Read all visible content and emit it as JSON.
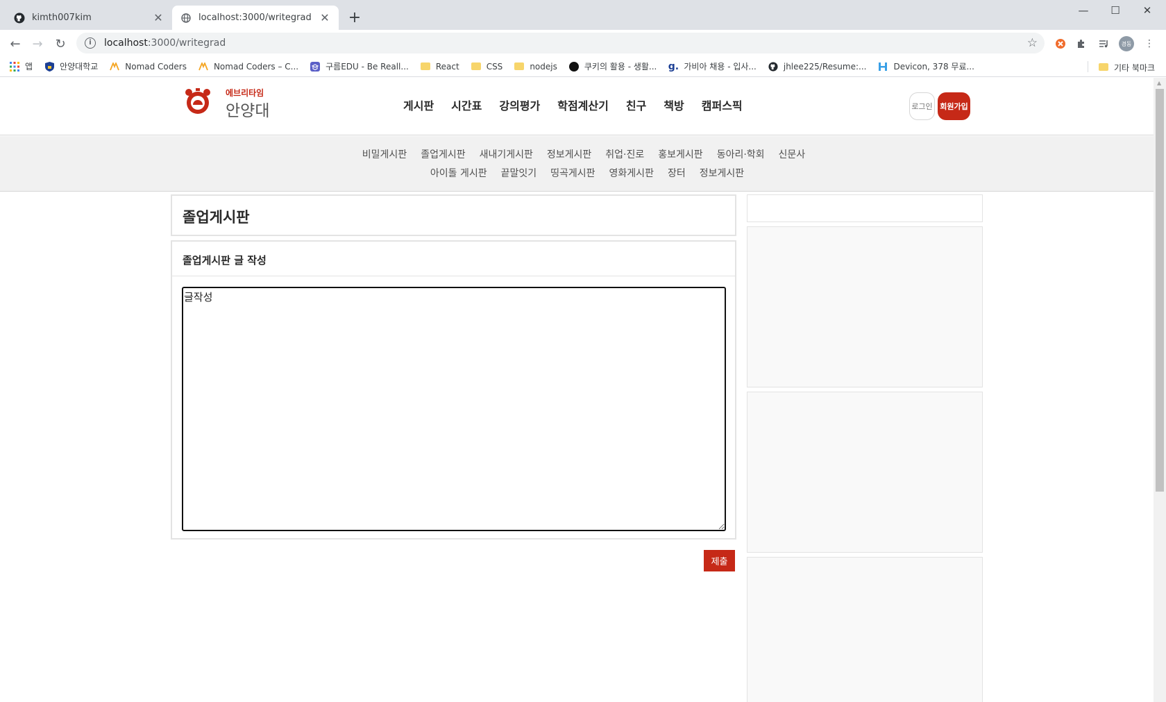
{
  "browser": {
    "tabs": [
      {
        "title": "kimth007kim",
        "close": "✕"
      },
      {
        "title": "localhost:3000/writegrad",
        "close": "✕"
      }
    ],
    "new_tab": "+",
    "window_controls": {
      "minimize": "—",
      "maximize": "☐",
      "close": "✕"
    },
    "nav": {
      "back": "←",
      "forward": "→",
      "reload": "↻"
    },
    "address": {
      "host": "localhost",
      "path": ":3000/writegrad"
    },
    "profile_label": "경동",
    "bookmarks": [
      {
        "label": "앱",
        "icon": "apps-grid-icon"
      },
      {
        "label": "안양대학교",
        "icon": "shield-icon"
      },
      {
        "label": "Nomad Coders",
        "icon": "nomad-icon"
      },
      {
        "label": "Nomad Coders – C...",
        "icon": "nomad-icon"
      },
      {
        "label": "구름EDU - Be Reall...",
        "icon": "goorm-icon"
      },
      {
        "label": "React",
        "icon": "folder-icon"
      },
      {
        "label": "CSS",
        "icon": "folder-icon"
      },
      {
        "label": "nodejs",
        "icon": "folder-icon"
      },
      {
        "label": "쿠키의 활용 - 생활...",
        "icon": "dot-icon"
      },
      {
        "label": "가비아 채용 - 입사...",
        "icon": "gabia-icon"
      },
      {
        "label": "jhlee225/Resume:...",
        "icon": "github-icon"
      },
      {
        "label": "Devicon, 378 무료...",
        "icon": "devicon-icon"
      }
    ],
    "other_bookmarks": "기타 북마크"
  },
  "site": {
    "logo_sub": "에브리타임",
    "logo_main": "안양대",
    "gnb": [
      "게시판",
      "시간표",
      "강의평가",
      "학점계산기",
      "친구",
      "책방",
      "캠퍼스픽"
    ],
    "login_label": "로그인",
    "signup_label": "회원가입",
    "subnav_row1": [
      "비밀게시판",
      "졸업게시판",
      "새내기게시판",
      "정보게시판",
      "취업·진로",
      "홍보게시판",
      "동아리·학회",
      "신문사"
    ],
    "subnav_row2": [
      "아이돌 게시판",
      "끝말잇기",
      "띵곡게시판",
      "영화게시판",
      "장터",
      "정보게시판"
    ]
  },
  "main": {
    "board_title": "졸업게시판",
    "write_header": "졸업게시판 글 작성",
    "textarea_value": "글작성",
    "submit_label": "제출"
  },
  "colors": {
    "brand_red": "#c62917"
  }
}
